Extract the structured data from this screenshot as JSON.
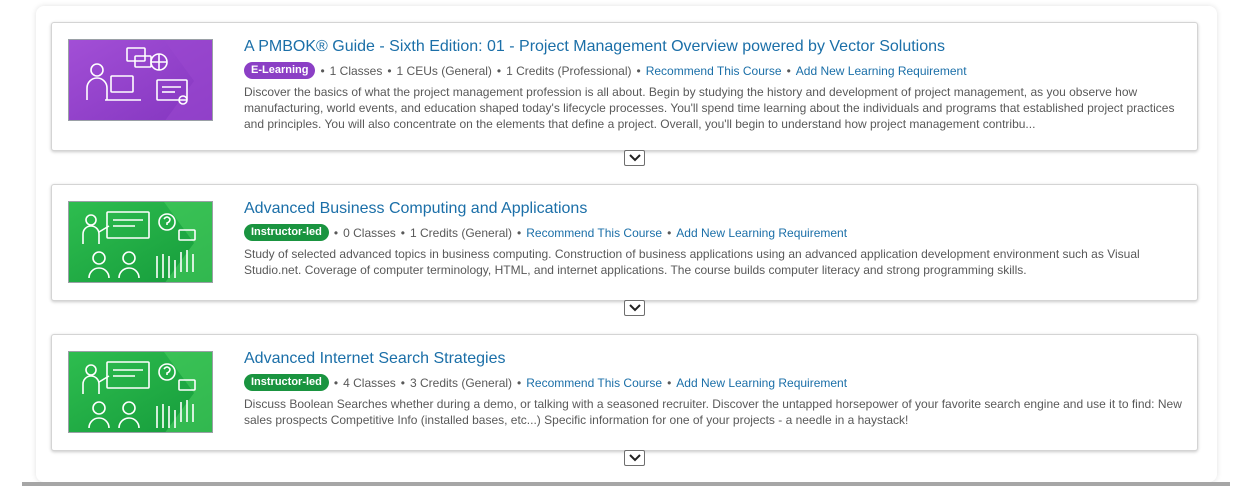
{
  "colors": {
    "link": "#1b6fa8",
    "elearning_badge": "#8b3fc5",
    "instructor_badge": "#1a9440"
  },
  "courses": [
    {
      "title": "A PMBOK® Guide - Sixth Edition: 01 - Project Management Overview powered by Vector Solutions",
      "badge": "E-Learning",
      "stats": [
        "1 Classes",
        "1 CEUs (General)",
        "1 Credits (Professional)"
      ],
      "recommend_label": "Recommend This Course",
      "add_requirement_label": "Add New Learning Requirement",
      "description": "Discover the basics of what the project management profession is all about. Begin by studying the history and development of project management, as you observe how manufacturing, world events, and education shaped today's lifecycle processes. You'll spend time learning about the individuals and programs that established project practices and principles. You will also concentrate on the elements that define a project. Overall, you'll begin to understand how project management contribu...",
      "thumbnail_icon": "elearning-computer-icon"
    },
    {
      "title": "Advanced Business Computing and Applications",
      "badge": "Instructor-led",
      "stats": [
        "0 Classes",
        "1 Credits (General)"
      ],
      "recommend_label": "Recommend This Course",
      "add_requirement_label": "Add New Learning Requirement",
      "description": "Study of selected advanced topics in business computing. Construction of business applications using an advanced application development environment such as Visual Studio.net. Coverage of computer terminology, HTML, and internet applications. The course builds computer literacy and strong programming skills.",
      "thumbnail_icon": "classroom-presentation-icon"
    },
    {
      "title": "Advanced Internet Search Strategies",
      "badge": "Instructor-led",
      "stats": [
        "4 Classes",
        "3 Credits (General)"
      ],
      "recommend_label": "Recommend This Course",
      "add_requirement_label": "Add New Learning Requirement",
      "description": "Discuss Boolean Searches whether during a demo, or talking with a seasoned recruiter. Discover the untapped horsepower of your favorite search engine and use it to find: New sales prospects Competitive Info (installed bases, etc...) Specific information for one of your projects - a needle in a haystack!",
      "thumbnail_icon": "classroom-presentation-icon"
    }
  ]
}
